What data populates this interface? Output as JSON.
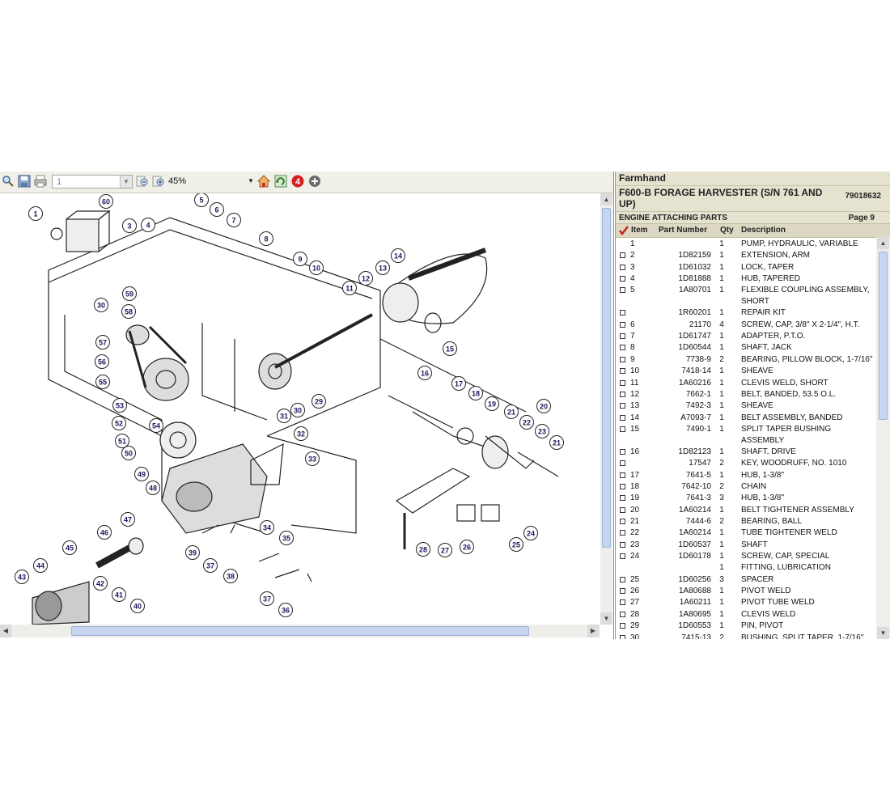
{
  "viewer": {
    "page_number": "1",
    "zoom_value": "45%",
    "notification_count": "4"
  },
  "drawing": {
    "callouts": [
      "1",
      "3",
      "4",
      "5",
      "6",
      "7",
      "8",
      "9",
      "10",
      "11",
      "12",
      "13",
      "14",
      "15",
      "16",
      "17",
      "18",
      "19",
      "20",
      "21",
      "21",
      "22",
      "23",
      "24",
      "25",
      "26",
      "27",
      "28",
      "29",
      "30",
      "30",
      "31",
      "32",
      "33",
      "34",
      "35",
      "36",
      "37",
      "37",
      "38",
      "39",
      "40",
      "41",
      "42",
      "43",
      "44",
      "45",
      "46",
      "47",
      "48",
      "49",
      "50",
      "51",
      "52",
      "53",
      "54",
      "55",
      "56",
      "57",
      "58",
      "59",
      "60"
    ]
  },
  "panel": {
    "brand": "Farmhand",
    "model_title": "F600-B FORAGE HARVESTER (S/N 761 AND UP)",
    "catalog_number": "79018632",
    "section_name": "ENGINE ATTACHING PARTS",
    "page_label": "Page 9",
    "columns": {
      "item": "Item",
      "part_number": "Part Number",
      "qty": "Qty",
      "description": "Description"
    },
    "rows": [
      {
        "item": "1",
        "part": "",
        "qty": "1",
        "desc": "PUMP, HYDRAULIC, VARIABLE",
        "checkbox": false,
        "lines": 1
      },
      {
        "item": "2",
        "part": "1D82159",
        "qty": "1",
        "desc": "EXTENSION, ARM",
        "checkbox": true,
        "lines": 1
      },
      {
        "item": "3",
        "part": "1D61032",
        "qty": "1",
        "desc": "LOCK, TAPER",
        "checkbox": true,
        "lines": 1
      },
      {
        "item": "4",
        "part": "1D81888",
        "qty": "1",
        "desc": "HUB, TAPERED",
        "checkbox": true,
        "lines": 1
      },
      {
        "item": "5",
        "part": "1A80701",
        "qty": "1",
        "desc": "FLEXIBLE COUPLING ASSEMBLY, SHORT",
        "checkbox": true,
        "lines": 2
      },
      {
        "item": "",
        "part": "1R60201",
        "qty": "1",
        "desc": "REPAIR KIT",
        "checkbox": true,
        "lines": 1
      },
      {
        "item": "6",
        "part": "21170",
        "qty": "4",
        "desc": "SCREW, CAP, 3/8\" X 2-1/4\", H.T.",
        "checkbox": true,
        "lines": 1
      },
      {
        "item": "7",
        "part": "1D61747",
        "qty": "1",
        "desc": "ADAPTER, P.T.O.",
        "checkbox": true,
        "lines": 1
      },
      {
        "item": "8",
        "part": "1D60544",
        "qty": "1",
        "desc": "SHAFT, JACK",
        "checkbox": true,
        "lines": 1
      },
      {
        "item": "9",
        "part": "7738-9",
        "qty": "2",
        "desc": "BEARING, PILLOW BLOCK, 1-7/16\"",
        "checkbox": true,
        "lines": 1
      },
      {
        "item": "10",
        "part": "7418-14",
        "qty": "1",
        "desc": "SHEAVE",
        "checkbox": true,
        "lines": 1
      },
      {
        "item": "11",
        "part": "1A60216",
        "qty": "1",
        "desc": "CLEVIS WELD, SHORT",
        "checkbox": true,
        "lines": 1
      },
      {
        "item": "12",
        "part": "7662-1",
        "qty": "1",
        "desc": "BELT, BANDED, 53.5 O.L.",
        "checkbox": true,
        "lines": 1
      },
      {
        "item": "13",
        "part": "7492-3",
        "qty": "1",
        "desc": "SHEAVE",
        "checkbox": true,
        "lines": 1
      },
      {
        "item": "14",
        "part": "A7093-7",
        "qty": "1",
        "desc": "BELT ASSEMBLY, BANDED",
        "checkbox": true,
        "lines": 1
      },
      {
        "item": "15",
        "part": "7490-1",
        "qty": "1",
        "desc": "SPLIT TAPER BUSHING ASSEMBLY",
        "checkbox": true,
        "lines": 2
      },
      {
        "item": "16",
        "part": "1D82123",
        "qty": "1",
        "desc": "SHAFT, DRIVE",
        "checkbox": true,
        "lines": 1
      },
      {
        "item": "",
        "part": "17547",
        "qty": "2",
        "desc": "KEY, WOODRUFF, NO. 1010",
        "checkbox": true,
        "lines": 1
      },
      {
        "item": "17",
        "part": "7641-5",
        "qty": "1",
        "desc": "HUB, 1-3/8\"",
        "checkbox": true,
        "lines": 1
      },
      {
        "item": "18",
        "part": "7642-10",
        "qty": "2",
        "desc": "CHAIN",
        "checkbox": true,
        "lines": 1
      },
      {
        "item": "19",
        "part": "7641-3",
        "qty": "3",
        "desc": "HUB, 1-3/8\"",
        "checkbox": true,
        "lines": 1
      },
      {
        "item": "20",
        "part": "1A60214",
        "qty": "1",
        "desc": "BELT TIGHTENER ASSEMBLY",
        "checkbox": true,
        "lines": 1
      },
      {
        "item": "21",
        "part": "7444-6",
        "qty": "2",
        "desc": "BEARING, BALL",
        "checkbox": true,
        "lines": 1
      },
      {
        "item": "22",
        "part": "1A60214",
        "qty": "1",
        "desc": "TUBE TIGHTENER WELD",
        "checkbox": true,
        "lines": 1
      },
      {
        "item": "23",
        "part": "1D60537",
        "qty": "1",
        "desc": "SHAFT",
        "checkbox": true,
        "lines": 1
      },
      {
        "item": "24",
        "part": "1D60178",
        "qty": "1",
        "desc": "SCREW, CAP, SPECIAL",
        "checkbox": true,
        "lines": 1
      },
      {
        "item": "",
        "part": "",
        "qty": "1",
        "desc": "FITTING, LUBRICATION",
        "checkbox": false,
        "lines": 1
      },
      {
        "item": "25",
        "part": "1D60256",
        "qty": "3",
        "desc": "SPACER",
        "checkbox": true,
        "lines": 1
      },
      {
        "item": "26",
        "part": "1A80688",
        "qty": "1",
        "desc": "PIVOT WELD",
        "checkbox": true,
        "lines": 1
      },
      {
        "item": "27",
        "part": "1A60211",
        "qty": "1",
        "desc": "PIVOT TUBE WELD",
        "checkbox": true,
        "lines": 1
      },
      {
        "item": "28",
        "part": "1A80695",
        "qty": "1",
        "desc": "CLEVIS WELD",
        "checkbox": true,
        "lines": 1
      },
      {
        "item": "29",
        "part": "1D60553",
        "qty": "1",
        "desc": "PIN, PIVOT",
        "checkbox": true,
        "lines": 1
      },
      {
        "item": "30",
        "part": "7415-13",
        "qty": "2",
        "desc": "BUSHING, SPLIT TAPER, 1-7/16\"",
        "checkbox": true,
        "lines": 1
      }
    ]
  },
  "colors": {
    "panel_header_bg": "#e6e2d0",
    "column_header_bg": "#dcd8c4",
    "scroll_thumb": "#c6d6f0",
    "callout_circle_fill": "#ffffff",
    "callout_text": "#1a1a5e",
    "notification_badge": "#d42020",
    "checkmark": "#c0261a"
  },
  "icons": {
    "toolbar": [
      "search-icon",
      "save-icon",
      "print-icon",
      "zoom-out-icon",
      "zoom-in-icon",
      "home-icon",
      "refresh-icon",
      "notification-badge-icon",
      "add-icon"
    ],
    "panel": [
      "checkmark-icon",
      "checkbox-icon"
    ]
  }
}
